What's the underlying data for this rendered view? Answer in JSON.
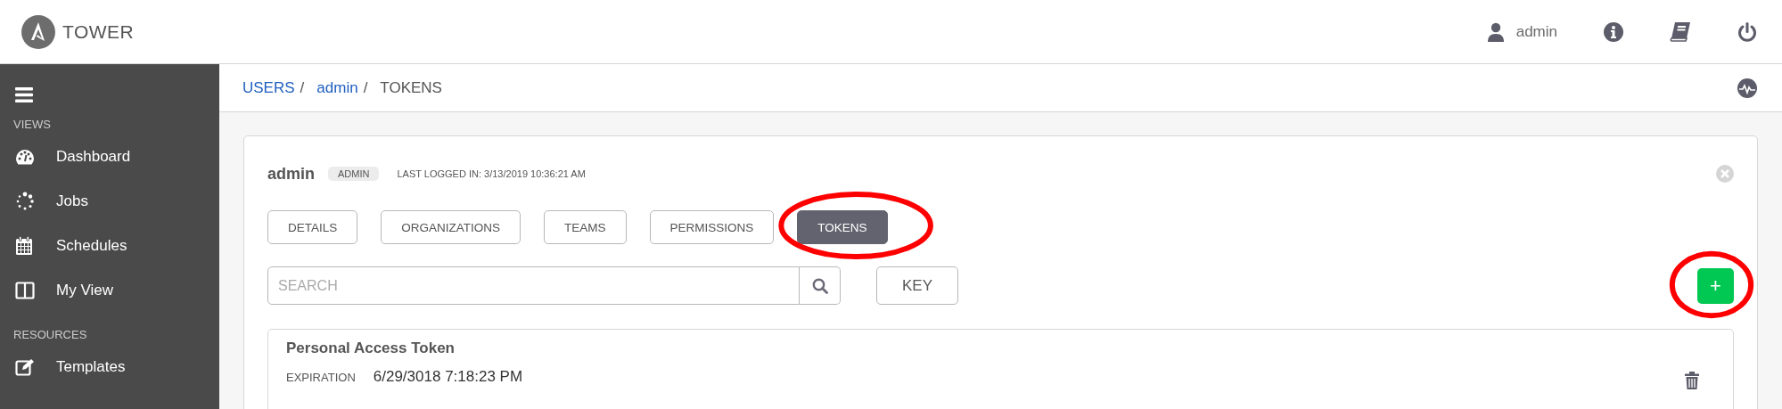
{
  "header": {
    "logo_text": "TOWER",
    "user": "admin"
  },
  "sidebar": {
    "sections": [
      {
        "heading": "VIEWS",
        "items": [
          {
            "label": "Dashboard",
            "kind": "dashboard"
          },
          {
            "label": "Jobs",
            "kind": "jobs"
          },
          {
            "label": "Schedules",
            "kind": "schedules"
          },
          {
            "label": "My View",
            "kind": "myview"
          }
        ]
      },
      {
        "heading": "RESOURCES",
        "items": [
          {
            "label": "Templates",
            "kind": "templates"
          }
        ]
      }
    ]
  },
  "breadcrumb": [
    {
      "label": "USERS",
      "kind": "link",
      "separator": "/"
    },
    {
      "label": "admin",
      "kind": "link",
      "separator": "/"
    },
    {
      "label": "TOKENS",
      "kind": "current"
    }
  ],
  "user_card": {
    "name": "admin",
    "badge": "ADMIN",
    "last_login": "LAST LOGGED IN: 3/13/2019 10:36:21 AM",
    "tabs": [
      {
        "label": "DETAILS",
        "selected": false,
        "highlighted": false
      },
      {
        "label": "ORGANIZATIONS",
        "selected": false,
        "highlighted": false
      },
      {
        "label": "TEAMS",
        "selected": false,
        "highlighted": false
      },
      {
        "label": "PERMISSIONS",
        "selected": false,
        "highlighted": false
      },
      {
        "label": "TOKENS",
        "selected": true,
        "highlighted": true
      }
    ],
    "search": {
      "placeholder": "SEARCH"
    },
    "key_button": "KEY",
    "add_button": {
      "label": "+",
      "highlighted": true
    },
    "tokens": [
      {
        "name": "Personal Access Token",
        "expiration_label": "EXPIRATION",
        "expiration": "6/29/3018 7:18:23 PM"
      }
    ]
  }
}
